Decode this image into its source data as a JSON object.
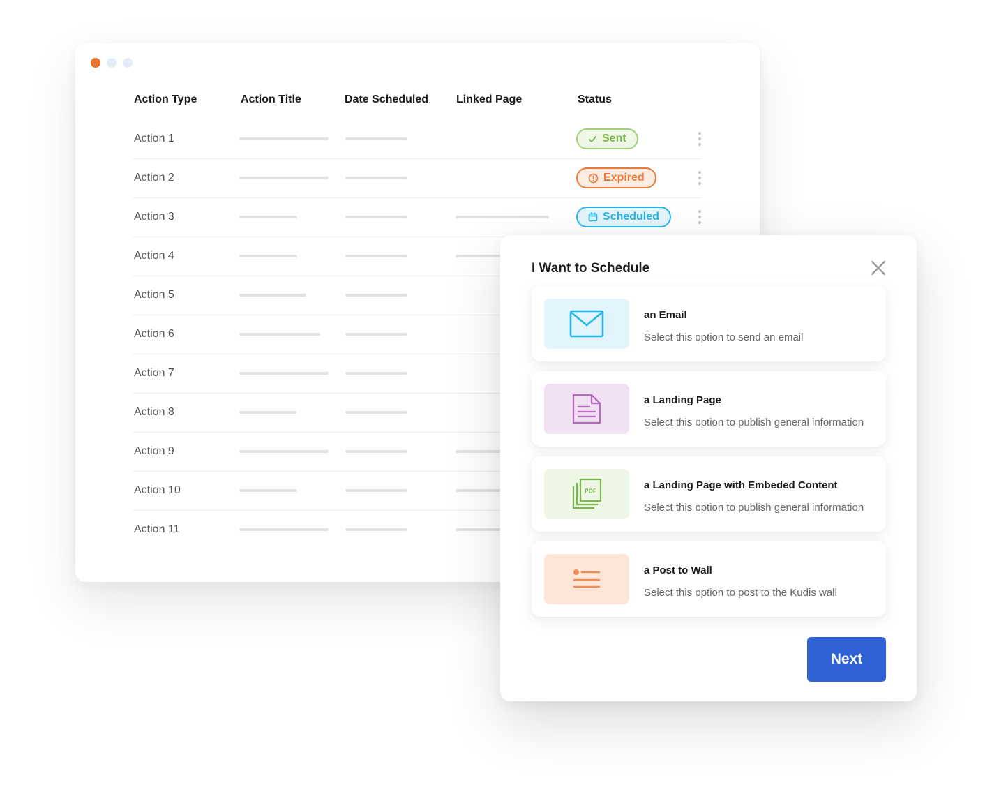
{
  "window": {
    "dots": [
      {
        "color": "#e8702a"
      },
      {
        "color": "#e3edf9"
      },
      {
        "color": "#e3edf9"
      }
    ]
  },
  "table": {
    "columns": [
      "Action Type",
      "Action Title",
      "Date Scheduled",
      "Linked Page",
      "Status"
    ],
    "rows": [
      {
        "type": "Action 1",
        "status": {
          "label": "Sent",
          "icon": "check-icon",
          "color": "#7bb64a",
          "bg": "#eef7e6"
        }
      },
      {
        "type": "Action 2",
        "status": {
          "label": "Expired",
          "icon": "alert-circle-icon",
          "color": "#ec7a35",
          "bg": "#fdece2"
        }
      },
      {
        "type": "Action 3",
        "status": {
          "label": "Scheduled",
          "icon": "calendar-icon",
          "color": "#27b4e8",
          "bg": "#e3f5fc"
        }
      },
      {
        "type": "Action 4"
      },
      {
        "type": "Action 5"
      },
      {
        "type": "Action 6"
      },
      {
        "type": "Action 7"
      },
      {
        "type": "Action 8"
      },
      {
        "type": "Action 9"
      },
      {
        "type": "Action 10"
      },
      {
        "type": "Action 11"
      }
    ]
  },
  "modal": {
    "title": "I Want to Schedule",
    "options": [
      {
        "title": "an Email",
        "desc": "Select this option to send an email",
        "icon": "envelope-icon",
        "bg": "#e3f5fc",
        "color": "#27b4e8"
      },
      {
        "title": "a Landing Page",
        "desc": "Select this option to publish general information",
        "icon": "document-icon",
        "bg": "#f1dff2",
        "color": "#b36abf"
      },
      {
        "title": "a Landing Page with Embeded Content",
        "desc": "Select this option to publish general information",
        "icon": "pdf-stack-icon",
        "icon_text": "PDF",
        "bg": "#eef7e6",
        "color": "#7bb64a"
      },
      {
        "title": "a Post to Wall",
        "desc": "Select this option to post to the Kudis wall",
        "icon": "list-icon",
        "bg": "#fde6d7",
        "color": "#ee8c5a"
      }
    ],
    "next_label": "Next"
  }
}
